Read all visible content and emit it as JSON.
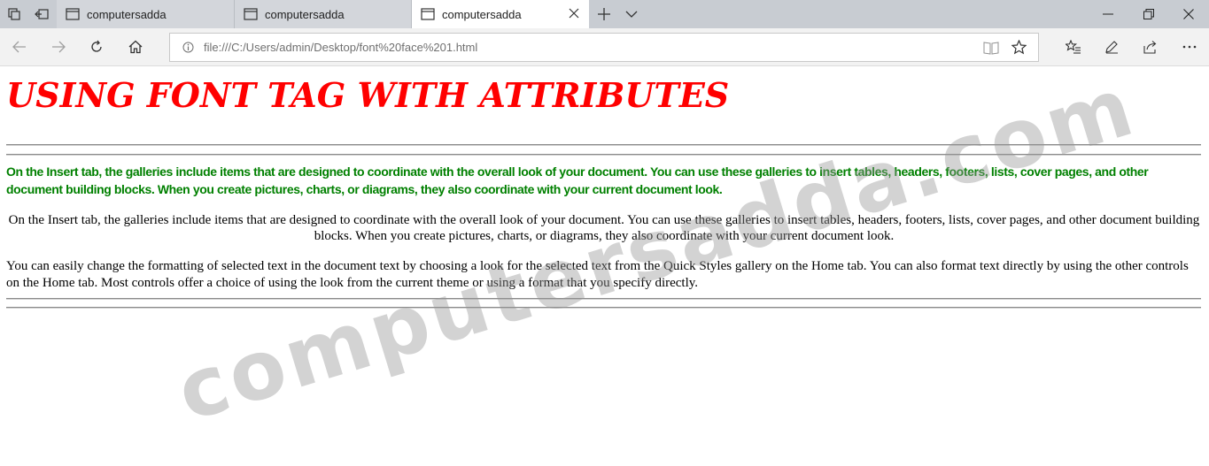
{
  "tabs": [
    {
      "label": "computersadda",
      "active": false
    },
    {
      "label": "computersadda",
      "active": false
    },
    {
      "label": "computersadda",
      "active": true
    }
  ],
  "address": {
    "url": "file:///C:/Users/admin/Desktop/font%20face%201.html"
  },
  "page": {
    "heading": "USING FONT TAG WITH ATTRIBUTES",
    "green_paragraph": "On the Insert tab, the galleries include items that are designed to coordinate with the overall look of your document. You can use these galleries to insert tables, headers, footers, lists, cover pages, and other document building blocks. When you create pictures, charts, or diagrams, they also coordinate with your current document look.",
    "center_paragraph": "On the Insert tab, the galleries include items that are designed to coordinate with the overall look of your document. You can use these galleries to insert tables, headers, footers, lists, cover pages, and other document building blocks. When you create pictures, charts, or diagrams, they also coordinate with your current document look.",
    "left_paragraph": "You can easily change the formatting of selected text in the document text by choosing a look for the selected text from the Quick Styles gallery on the Home tab. You can also format text directly by using the other controls on the Home tab. Most controls offer a choice of using the look from the current theme or using a format that you specify directly."
  },
  "watermark": "computersadda.com",
  "colors": {
    "heading": "#ff0000",
    "green_text": "#008000"
  }
}
